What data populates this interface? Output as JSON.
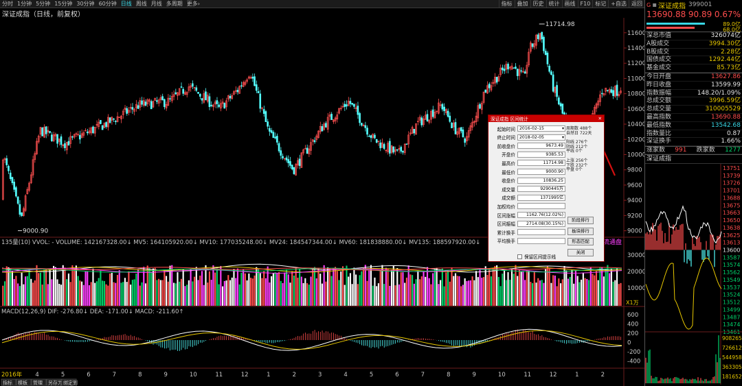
{
  "toolbar": {
    "left": [
      "分时",
      "1分钟",
      "5分钟",
      "15分钟",
      "30分钟",
      "60分钟",
      "日线",
      "周线",
      "月线",
      "多周期",
      "更多›"
    ],
    "active_index": 6,
    "right": [
      "指标",
      "叠加",
      "历史",
      "统计",
      "画线",
      "F10",
      "标记",
      "+自选",
      "返回"
    ]
  },
  "chart_title": "深证成指（日线，前复权）",
  "chart_data": {
    "type": "candlestick",
    "price_axis": {
      "labels": [
        "11600",
        "11400",
        "11200",
        "11000",
        "10800",
        "10600",
        "10400",
        "10200",
        "10000",
        "9800",
        "9600",
        "9400",
        "9200",
        "9000"
      ],
      "min": 8960,
      "max": 11760
    },
    "high_label": "11714.98",
    "low_label": "9000.90",
    "start": 9385.53,
    "end": 10836.25,
    "waypoints": [
      [
        0,
        10000
      ],
      [
        0.03,
        9150
      ],
      [
        0.06,
        10320
      ],
      [
        0.1,
        10150
      ],
      [
        0.17,
        10420
      ],
      [
        0.22,
        10650
      ],
      [
        0.27,
        10700
      ],
      [
        0.3,
        10900
      ],
      [
        0.35,
        10600
      ],
      [
        0.38,
        10850
      ],
      [
        0.4,
        11100
      ],
      [
        0.43,
        10300
      ],
      [
        0.47,
        9800
      ],
      [
        0.52,
        10400
      ],
      [
        0.56,
        10700
      ],
      [
        0.6,
        10200
      ],
      [
        0.64,
        10000
      ],
      [
        0.67,
        10400
      ],
      [
        0.71,
        10650
      ],
      [
        0.73,
        10350
      ],
      [
        0.75,
        10200
      ],
      [
        0.78,
        10850
      ],
      [
        0.82,
        11200
      ],
      [
        0.845,
        11000
      ],
      [
        0.85,
        11350
      ],
      [
        0.87,
        11600
      ],
      [
        0.89,
        10900
      ],
      [
        0.92,
        10200
      ],
      [
        0.95,
        10400
      ],
      [
        0.97,
        10850
      ],
      [
        1,
        10836
      ]
    ],
    "volume_label": "135量(10) VVOL: - VOLUME: 142167328.00↓ MV5: 164105920.00↓ MV10: 177035248.00↓ MV24: 184547344.00↓ MV60: 181838880.00↓ MV135: 188597920.00↓",
    "volume_axis": [
      "30000",
      "20000",
      "10000"
    ],
    "volume_unit": "X1万",
    "macd_label": "MACD(12,26,9) DIF: -276.80↓ DEA: -171.00↓ MACD: -211.60↑",
    "macd_axis": [
      "600",
      "400",
      "200",
      "0",
      "-200",
      "-400"
    ],
    "x_labels": [
      "2016年",
      "4",
      "5",
      "6",
      "7",
      "8",
      "9",
      "10",
      "11",
      "12",
      "1",
      "2",
      "3",
      "4",
      "5",
      "6",
      "7",
      "8",
      "9",
      "10",
      "11",
      "12",
      "1",
      "2"
    ],
    "tail_text": "流通盘"
  },
  "bottom_tabs": [
    "指标",
    "模板",
    "管理",
    "另存为",
    "绑定到"
  ],
  "right_panel": {
    "badge": "G",
    "name": "深证成指",
    "code": "399001",
    "price": "13690.88",
    "change": "90.89",
    "pct": "0.67%",
    "bar_vals": [
      "89.0亿",
      "68.0亿"
    ],
    "stats1": [
      {
        "k": "深总市值",
        "v": "326074亿",
        "c": "wht"
      },
      {
        "k": "A股成交",
        "v": "3994.30亿",
        "c": "yel"
      },
      {
        "k": "B股成交",
        "v": "2.28亿",
        "c": "yel"
      },
      {
        "k": "国债成交",
        "v": "1292.44亿",
        "c": "yel"
      },
      {
        "k": "基金成交",
        "v": "85.73亿",
        "c": "yel"
      }
    ],
    "stats2": [
      {
        "k": "今日开盘",
        "v": "13627.86",
        "c": "red"
      },
      {
        "k": "昨日收盘",
        "v": "13599.99",
        "c": "wht"
      },
      {
        "k": "指数振幅",
        "v": "148.20/1.09%",
        "c": "wht"
      },
      {
        "k": "总成交额",
        "v": "3996.59亿",
        "c": "yel"
      },
      {
        "k": "总成交量",
        "v": "310005529",
        "c": "yel"
      },
      {
        "k": "最高指数",
        "v": "13690.88",
        "c": "red"
      },
      {
        "k": "最低指数",
        "v": "13542.68",
        "c": "cyn"
      },
      {
        "k": "指数量比",
        "v": "0.87",
        "c": "wht"
      },
      {
        "k": "深证换手",
        "v": "1.66%",
        "c": "wht"
      }
    ],
    "updown": {
      "up_label": "涨家数",
      "up": "991",
      "down_label": "跌家数",
      "down": "1277"
    },
    "mini_title": "深证成指",
    "mini_axis": [
      "13751",
      "13739",
      "13726",
      "13701",
      "13688",
      "13675",
      "13663",
      "13650",
      "13638",
      "13625",
      "13613",
      "13600",
      "13587",
      "13574",
      "13562",
      "13549",
      "13537",
      "13524",
      "13512",
      "13499",
      "13487",
      "13474",
      "13461"
    ],
    "mini_vol_axis": [
      "908265",
      "726612",
      "544958",
      "363305",
      "181652"
    ]
  },
  "dialog": {
    "title": "深证成指 区间统计",
    "close": "✕",
    "fields": [
      {
        "k": "起始时间",
        "v": "2016-02-15",
        "dd": true
      },
      {
        "k": "终止时间",
        "v": "2018-02-05",
        "dd": true
      },
      {
        "k": "前收盘价",
        "v": "9673.49"
      },
      {
        "k": "开盘价",
        "v": "9385.53"
      },
      {
        "k": "最高价",
        "v": "11714.98"
      },
      {
        "k": "最低价",
        "v": "9000.90"
      },
      {
        "k": "收盘价",
        "v": "10836.25"
      },
      {
        "k": "成交量",
        "v": "9290445万"
      },
      {
        "k": "成交额",
        "v": "1371995亿"
      },
      {
        "k": "加权均价",
        "v": ""
      },
      {
        "k": "区间涨幅",
        "v": "1162.76(12.02%)"
      },
      {
        "k": "区间振幅",
        "v": "2714.08(30.15%)"
      },
      {
        "k": "累计换手",
        "v": ""
      },
      {
        "k": "平均换手",
        "v": ""
      }
    ],
    "period": [
      "周期数 488个",
      "自然日 722天"
    ],
    "trend": [
      "阳线 276个",
      "阴线 212个",
      "平线 0个"
    ],
    "updays": [
      "上涨 256个",
      "下跌 232个",
      "平盘 0个"
    ],
    "buttons": [
      "阶段排行",
      "板块排行",
      "形态匹配",
      "关闭"
    ],
    "checkbox": "保留区间提示线"
  }
}
